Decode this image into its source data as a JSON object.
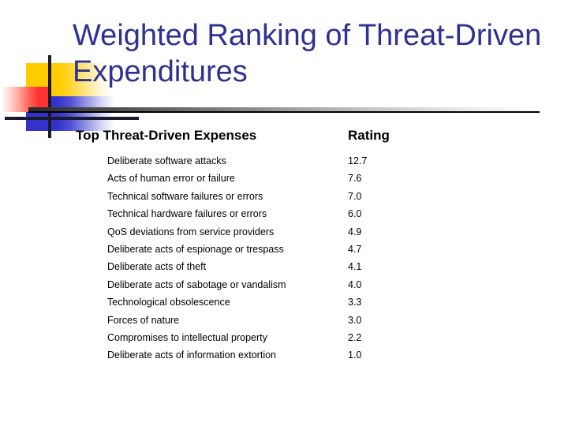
{
  "slide": {
    "title": "Weighted Ranking of Threat-Driven Expenditures",
    "title_color": "#2e3192"
  },
  "logo": {
    "yellow": "#ffcc00",
    "blue": "#3333cc",
    "red": "#ff3333",
    "bar": "#1a1a2e"
  },
  "table": {
    "headers": {
      "name": "Top Threat-Driven Expenses",
      "rating": "Rating"
    },
    "rows": [
      {
        "name": "Deliberate software attacks",
        "rating": "12.7"
      },
      {
        "name": "Acts of human error or failure",
        "rating": "7.6"
      },
      {
        "name": "Technical software failures or errors",
        "rating": "7.0"
      },
      {
        "name": "Technical hardware failures or errors",
        "rating": "6.0"
      },
      {
        "name": "QoS deviations from service providers",
        "rating": "4.9"
      },
      {
        "name": "Deliberate acts of espionage or trespass",
        "rating": "4.7"
      },
      {
        "name": "Deliberate acts of theft",
        "rating": "4.1"
      },
      {
        "name": "Deliberate acts of sabotage or vandalism",
        "rating": "4.0"
      },
      {
        "name": "Technological obsolescence",
        "rating": "3.3"
      },
      {
        "name": "Forces of nature",
        "rating": "3.0"
      },
      {
        "name": "Compromises to intellectual property",
        "rating": "2.2"
      },
      {
        "name": "Deliberate acts of information extortion",
        "rating": "1.0"
      }
    ]
  },
  "chart_data": {
    "type": "table",
    "title": "Weighted Ranking of Threat-Driven Expenditures",
    "categories": [
      "Deliberate software attacks",
      "Acts of human error or failure",
      "Technical software failures or errors",
      "Technical hardware failures or errors",
      "QoS deviations from service providers",
      "Deliberate acts of espionage or trespass",
      "Deliberate acts of theft",
      "Deliberate acts of sabotage or vandalism",
      "Technological obsolescence",
      "Forces of nature",
      "Compromises to intellectual property",
      "Deliberate acts of information extortion"
    ],
    "values": [
      12.7,
      7.6,
      7.0,
      6.0,
      4.9,
      4.7,
      4.1,
      4.0,
      3.3,
      3.0,
      2.2,
      1.0
    ],
    "xlabel": "Top Threat-Driven Expenses",
    "ylabel": "Rating",
    "ylim": [
      0,
      12.7
    ]
  }
}
